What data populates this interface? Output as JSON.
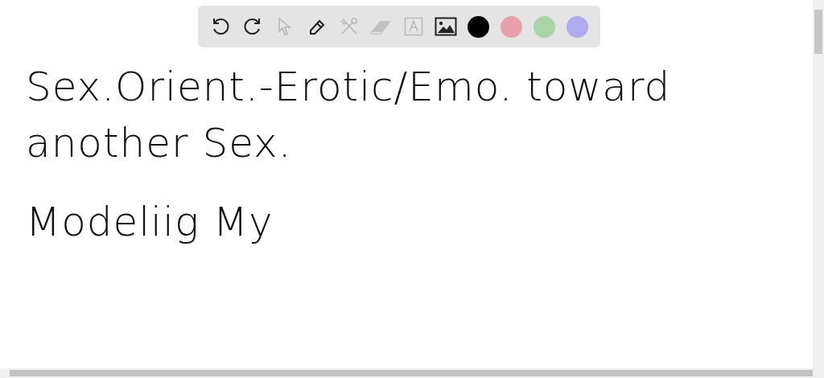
{
  "toolbar": {
    "tools": [
      {
        "kind": "undo",
        "disabled": false
      },
      {
        "kind": "redo",
        "disabled": false
      },
      {
        "kind": "select",
        "disabled": true
      },
      {
        "kind": "pen",
        "disabled": false
      },
      {
        "kind": "tools",
        "disabled": true
      },
      {
        "kind": "eraser",
        "disabled": true
      },
      {
        "kind": "text",
        "disabled": true
      },
      {
        "kind": "image",
        "disabled": false
      }
    ],
    "colors": [
      {
        "color": "#000000"
      },
      {
        "color": "#e8a0aa"
      },
      {
        "color": "#a8d4a8"
      },
      {
        "color": "#b0aaee"
      }
    ]
  },
  "canvas": {
    "lines": [
      "Sex.Orient.-Erotic/Emo. toward",
      "another Sex.",
      "Modeliig My"
    ]
  }
}
